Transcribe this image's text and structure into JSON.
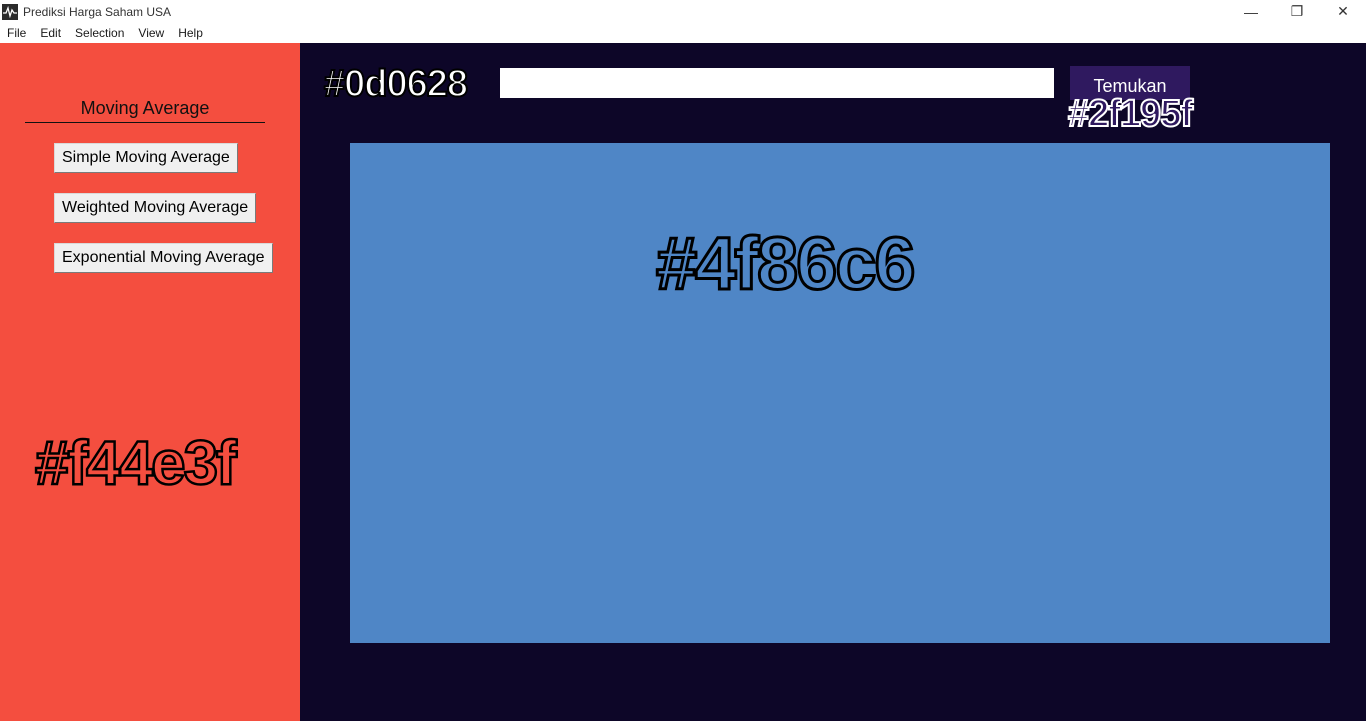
{
  "window": {
    "title": "Prediksi Harga Saham USA",
    "icon": "chart-line-icon",
    "controls": {
      "minimize": "—",
      "maximize": "❐",
      "close": "✕"
    }
  },
  "menubar": {
    "items": [
      "File",
      "Edit",
      "Selection",
      "View",
      "Help"
    ]
  },
  "sidebar": {
    "heading": "Moving Average",
    "background": "#f44e3f",
    "color_label": "#f44e3f",
    "buttons": [
      "Simple Moving Average",
      "Weighted Moving Average",
      "Exponential Moving Average"
    ]
  },
  "main": {
    "background": "#0d0628",
    "color_label": "#0d0628",
    "search": {
      "value": "",
      "placeholder": ""
    },
    "find_button": {
      "label": "Temukan",
      "background": "#2f195f",
      "color_label": "#2f195f"
    },
    "chart_area": {
      "background": "#4f86c6",
      "color_label": "#4f86c6"
    }
  }
}
